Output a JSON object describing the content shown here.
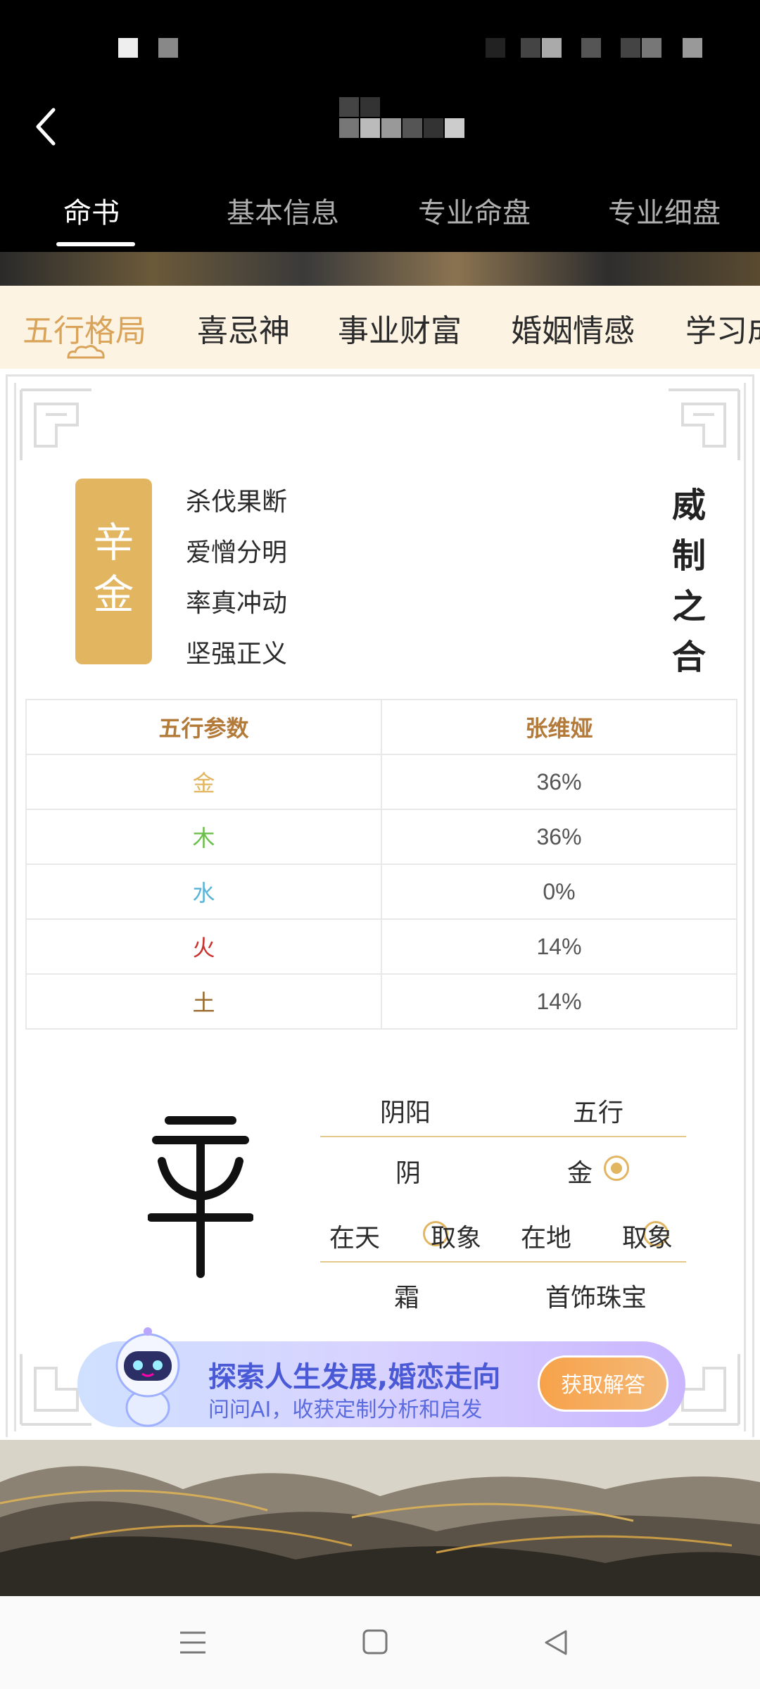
{
  "tabs": [
    "命书",
    "基本信息",
    "专业命盘",
    "专业细盘"
  ],
  "sub_tabs": [
    "五行格局",
    "喜忌神",
    "事业财富",
    "婚姻情感",
    "学习成"
  ],
  "badge": {
    "chars": [
      "辛",
      "金"
    ],
    "color": "#e2b560"
  },
  "traits": [
    "杀伐果断",
    "爱憎分明",
    "率真冲动",
    "坚强正义"
  ],
  "seal": [
    "威",
    "制",
    "之",
    "合"
  ],
  "wuxing_table": {
    "headers": [
      "五行参数",
      "张维娅"
    ],
    "rows": [
      {
        "element": "金",
        "value": "36%",
        "color": "#e2b560"
      },
      {
        "element": "木",
        "value": "36%",
        "color": "#6cbf4a"
      },
      {
        "element": "水",
        "value": "0%",
        "color": "#5bb5d8"
      },
      {
        "element": "火",
        "value": "14%",
        "color": "#c8322f"
      },
      {
        "element": "土",
        "value": "14%",
        "color": "#9a6a2a"
      }
    ]
  },
  "attributes": {
    "yinyang_label": "阴阳",
    "wuxing_label": "五行",
    "yinyang_value": "阴",
    "wuxing_value": "金",
    "sky_label": "在天",
    "sky_action": "取象",
    "earth_label": "在地",
    "earth_action": "取象",
    "sky_value": "霜",
    "earth_value": "首饰珠宝"
  },
  "ai_banner": {
    "title": "探索人生发展,婚恋走向",
    "subtitle": "问问AI，收获定制分析和启发",
    "button": "获取解答"
  }
}
